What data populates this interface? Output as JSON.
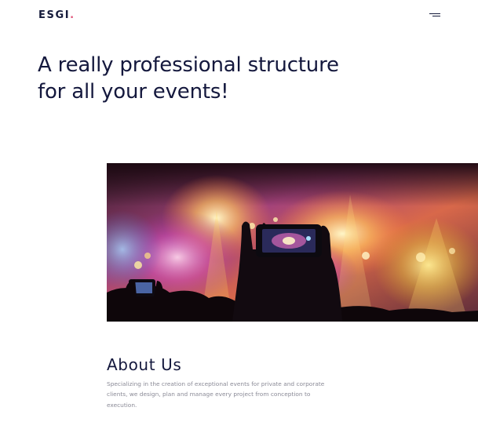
{
  "header": {
    "logo_text": "ESGI",
    "logo_dot": ".",
    "menu_icon": "hamburger-menu-icon"
  },
  "hero": {
    "title": "A really professional structure for all your events!",
    "image": "concert-crowd-photo"
  },
  "about": {
    "title": "About Us",
    "text": "Specializing in the creation of exceptional events for private and corporate clients, we design, plan and manage every project from conception to execution."
  },
  "colors": {
    "text_dark": "#14183d",
    "accent": "#e0567a",
    "muted_text": "#8a8a96"
  }
}
